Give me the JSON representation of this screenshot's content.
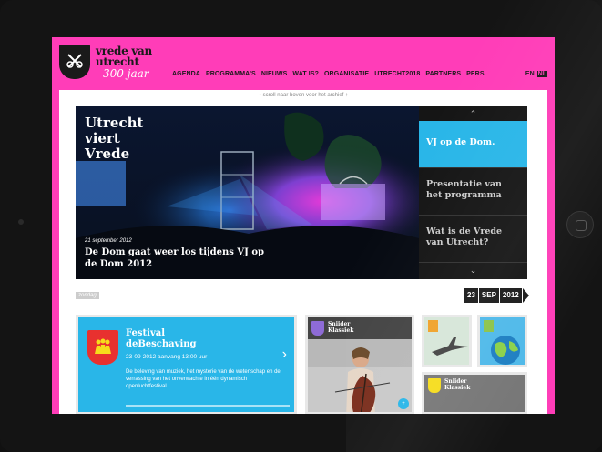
{
  "site": {
    "logo_line1": "vrede van",
    "logo_line2": "utrecht",
    "logo_line3": "300 jaar"
  },
  "nav": {
    "items": [
      {
        "label": "AGENDA"
      },
      {
        "label": "PROGRAMMA'S"
      },
      {
        "label": "NIEUWS"
      },
      {
        "label": "WAT IS?"
      },
      {
        "label": "ORGANISATIE"
      },
      {
        "label": "UTRECHT2018"
      },
      {
        "label": "PARTNERS"
      },
      {
        "label": "PERS"
      }
    ],
    "lang_en": "EN",
    "lang_nl": "NL"
  },
  "scroll_hint": "↑ scroll naar boven voor het archief ↑",
  "hero": {
    "title": "Utrecht\nviert\nVrede",
    "date": "21 september 2012",
    "caption": "De Dom gaat weer los tijdens VJ op de Dom 2012"
  },
  "side_menu": {
    "up_icon": "chevron-up-icon",
    "down_icon": "chevron-down-icon",
    "items": [
      {
        "label": "VJ op de Dom."
      },
      {
        "label": "Presentatie van het programma"
      },
      {
        "label": "Wat is de Vrede van Utrecht?"
      }
    ]
  },
  "date_bar": {
    "day_label": "zondag",
    "day": "23",
    "month": "SEP",
    "year": "2012"
  },
  "festival": {
    "title": "Festival deBeschaving",
    "when": "23-09-2012 aanvang 13:00 uur",
    "description": "De beleving van muziek, het mysterie van de wetenschap en de verrassing van het onverwachte in één dynamisch openluchtfestival.",
    "accent": "#29b6e8"
  },
  "tiles": {
    "music_label": "Sniider\nKlassiek",
    "music_plus": "+",
    "bottom_label": "Sniider\nKlassiek"
  },
  "colors": {
    "brand_pink": "#ff3db8",
    "highlight_blue": "#29b6e8",
    "dark": "#151515"
  }
}
